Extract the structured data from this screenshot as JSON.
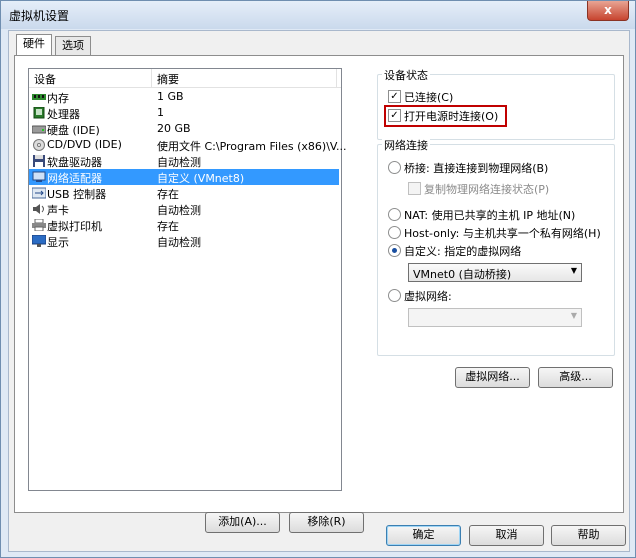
{
  "window": {
    "title": "虚拟机设置",
    "close_label": "x"
  },
  "tabs": [
    {
      "label": "硬件"
    },
    {
      "label": "选项"
    }
  ],
  "device_list": {
    "headers": {
      "device": "设备",
      "summary": "摘要"
    },
    "rows": [
      {
        "name": "内存",
        "summary": "1 GB",
        "icon": "memory-icon"
      },
      {
        "name": "处理器",
        "summary": "1",
        "icon": "processor-icon"
      },
      {
        "name": "硬盘 (IDE)",
        "summary": "20 GB",
        "icon": "hard-disk-icon"
      },
      {
        "name": "CD/DVD (IDE)",
        "summary": "使用文件 C:\\Program Files (x86)\\V...",
        "icon": "cd-dvd-icon"
      },
      {
        "name": "软盘驱动器",
        "summary": "自动检测",
        "icon": "floppy-icon"
      },
      {
        "name": "网络适配器",
        "summary": "自定义 (VMnet8)",
        "icon": "network-adapter-icon",
        "selected": true
      },
      {
        "name": "USB 控制器",
        "summary": "存在",
        "icon": "usb-icon"
      },
      {
        "name": "声卡",
        "summary": "自动检测",
        "icon": "sound-card-icon"
      },
      {
        "name": "虚拟打印机",
        "summary": "存在",
        "icon": "printer-icon"
      },
      {
        "name": "显示",
        "summary": "自动检测",
        "icon": "display-icon"
      }
    ]
  },
  "list_buttons": {
    "add": "添加(A)...",
    "remove": "移除(R)"
  },
  "device_status": {
    "title": "设备状态",
    "connected": {
      "label": "已连接(C)",
      "checked": true
    },
    "connect_at_power_on": {
      "label": "打开电源时连接(O)",
      "checked": true
    }
  },
  "network_connection": {
    "title": "网络连接",
    "bridged": {
      "label": "桥接: 直接连接到物理网络(B)"
    },
    "replicate": {
      "label": "复制物理网络连接状态(P)"
    },
    "nat": {
      "label": "NAT: 使用已共享的主机 IP 地址(N)"
    },
    "host_only": {
      "label": "Host-only: 与主机共享一个私有网络(H)"
    },
    "custom": {
      "label": "自定义: 指定的虚拟网络",
      "selected": true
    },
    "custom_select_value": "VMnet0 (自动桥接)",
    "lan_segment": {
      "label": "虚拟网络:"
    },
    "lan_select_value": ""
  },
  "panel_buttons": {
    "virtual_network": "虚拟网络...",
    "advanced": "高级..."
  },
  "dialog_buttons": {
    "ok": "确定",
    "cancel": "取消",
    "help": "帮助"
  },
  "check_mark": "✓",
  "arrow_glyph": "▼"
}
